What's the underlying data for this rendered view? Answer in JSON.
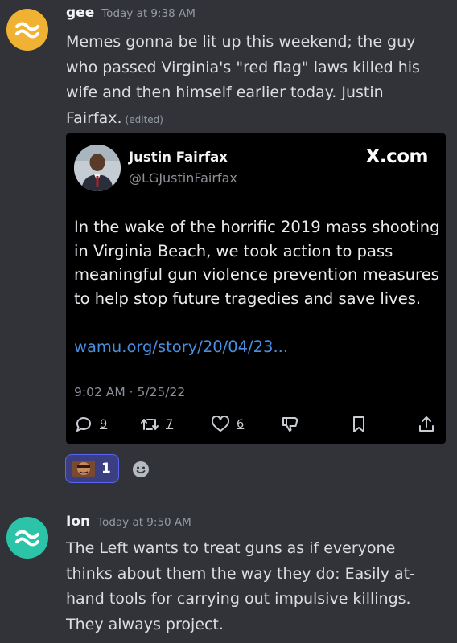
{
  "messages": [
    {
      "username": "gee",
      "timestamp": "Today at 9:38 AM",
      "avatar_color": "#f0b232",
      "content": "Memes gonna be lit up this weekend; the guy who passed Virginia's \"red flag\" laws killed his wife and then himself earlier today. Justin Fairfax.",
      "edited_label": "(edited)"
    },
    {
      "username": "Ion",
      "timestamp": "Today at 9:50 AM",
      "avatar_color": "#2cc4a8",
      "content": "The Left wants to treat guns as if everyone thinks about them the way they do: Easily at-hand tools for carrying out impulsive killings. They always project."
    }
  ],
  "embed": {
    "display_name": "Justin Fairfax",
    "handle": "@LGJustinFairfax",
    "brand": "X.com",
    "text": "In the wake of the horrific 2019 mass shooting in Virginia Beach, we took action to pass meaningful gun violence prevention measures to help stop future tragedies and save lives.",
    "link": "wamu.org/story/20/04/23...",
    "date": "9:02 AM · 5/25/22",
    "replies": "9",
    "retweets": "7",
    "likes": "6",
    "link_color": "#4a8fe0"
  },
  "reaction": {
    "count": "1",
    "accent": "#5865f2"
  },
  "colors": {
    "background": "#313338",
    "embed_background": "#000000"
  }
}
